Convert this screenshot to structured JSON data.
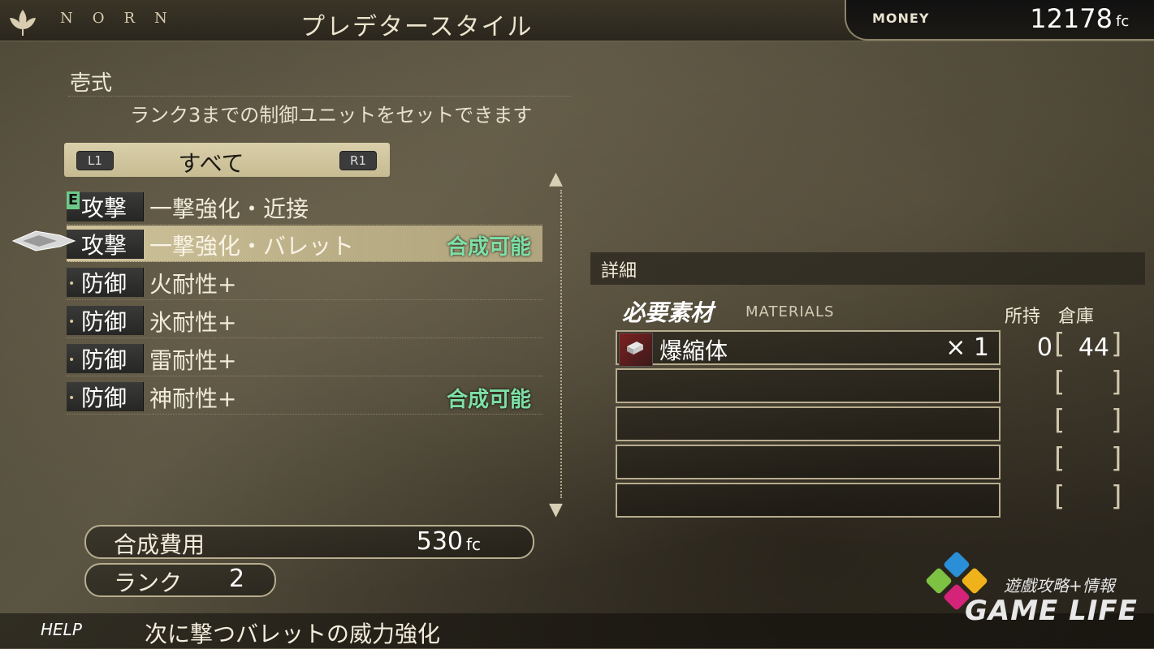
{
  "header": {
    "brand": "NORN",
    "title": "プレデタースタイル",
    "money_label": "MONEY",
    "money_value": "12178",
    "money_unit": "fc"
  },
  "style": {
    "name": "壱式",
    "description": "ランク3までの制御ユニットをセットできます"
  },
  "filter": {
    "left_button": "L1",
    "right_button": "R1",
    "label": "すべて"
  },
  "equipped_mark": "E",
  "units": [
    {
      "category": "攻撃",
      "name": "一撃強化・近接",
      "badge": ""
    },
    {
      "category": "攻撃",
      "name": "一撃強化・バレット",
      "badge": "合成可能"
    },
    {
      "category": "防御",
      "name": "火耐性+",
      "badge": ""
    },
    {
      "category": "防御",
      "name": "氷耐性+",
      "badge": ""
    },
    {
      "category": "防御",
      "name": "雷耐性+",
      "badge": ""
    },
    {
      "category": "防御",
      "name": "神耐性+",
      "badge": "合成可能"
    }
  ],
  "cost": {
    "label": "合成費用",
    "value": "530",
    "unit": "fc"
  },
  "rank": {
    "label": "ランク",
    "value": "2"
  },
  "help": {
    "label": "HELP",
    "text": "次に撃つバレットの威力強化"
  },
  "details": {
    "label": "詳細",
    "materials_title": "必要素材",
    "materials_subtitle": "MATERIALS",
    "owned_header": "所持",
    "storage_header": "倉庫",
    "materials": [
      {
        "name": "爆縮体",
        "qty": "× 1",
        "owned": "0",
        "storage": "44"
      }
    ]
  },
  "watermark": {
    "cn": "遊戲攻略+情報",
    "en": "GAME LIFE"
  }
}
